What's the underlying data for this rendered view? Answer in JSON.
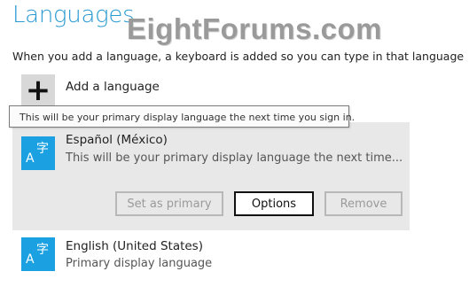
{
  "header": {
    "title": "Languages",
    "subtitle": "When you add a language, a keyboard is added so you can type in that language"
  },
  "watermark": "EightForums.com",
  "add_language": {
    "icon": "plus-icon",
    "label": "Add a language"
  },
  "tooltip": "This will be your primary display language the next time you sign in.",
  "languages": [
    {
      "name": "Español (México)",
      "description": "This will be your primary display language the next time...",
      "icon": "language-icon",
      "selected": true,
      "buttons": {
        "set_primary": "Set as primary",
        "options": "Options",
        "remove": "Remove"
      }
    },
    {
      "name": "English (United States)",
      "description": "Primary display language",
      "icon": "language-icon",
      "selected": false
    }
  ],
  "icon_glyphs": {
    "a": "A",
    "z": "字"
  },
  "colors": {
    "accent": "#2a9ad3",
    "icon_bg": "#1ba1e2",
    "selected_bg": "#e8e8e8"
  }
}
